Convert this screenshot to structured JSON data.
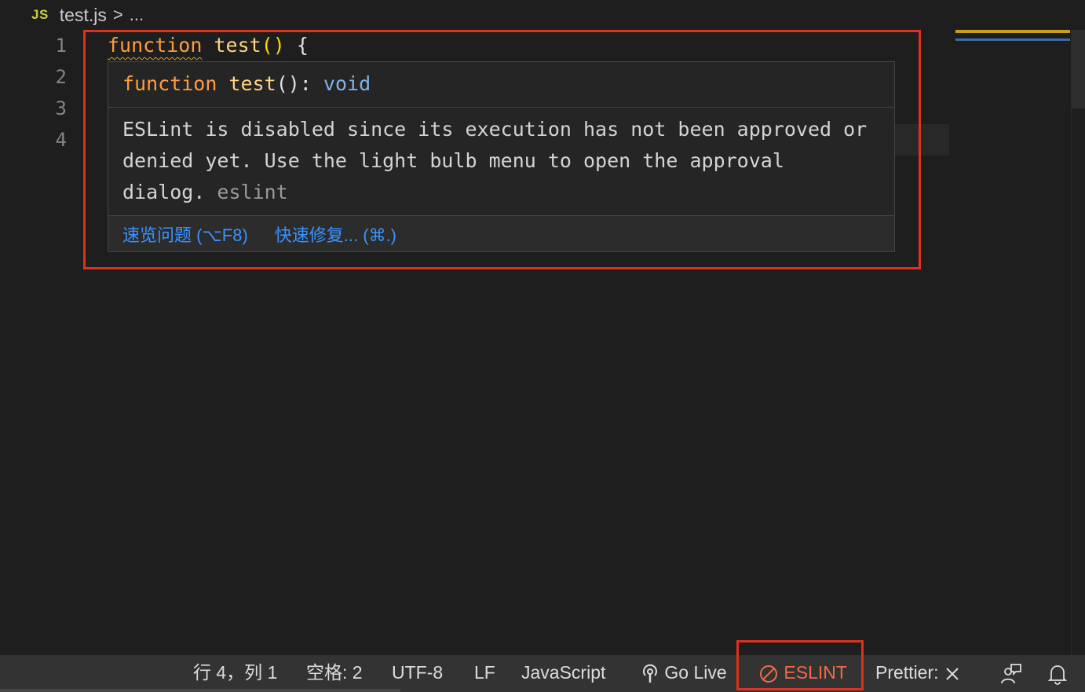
{
  "breadcrumb": {
    "file_icon": "JS",
    "file_name": "test.js",
    "separator": ">",
    "more": "..."
  },
  "gutter": {
    "line_numbers": [
      "1",
      "2",
      "3",
      "4"
    ]
  },
  "code": {
    "line1": {
      "keyword": "function",
      "space": " ",
      "name": "test",
      "parens": "()",
      "space2": " ",
      "brace": "{"
    }
  },
  "hover": {
    "signature": {
      "keyword": "function",
      "name": "test",
      "parens": "():",
      "type": "void"
    },
    "message": "ESLint is disabled since its execution has not been approved or denied yet. Use the light bulb menu to open the approval dialog.",
    "source": "eslint",
    "actions": {
      "peek_problem": "速览问题 (⌥F8)",
      "quick_fix": "快速修复... (⌘.)"
    }
  },
  "statusbar": {
    "position": "行 4，列 1",
    "spaces": "空格: 2",
    "encoding": "UTF-8",
    "eol": "LF",
    "language": "JavaScript",
    "go_live": "Go Live",
    "eslint": "ESLINT",
    "prettier": "Prettier:"
  },
  "colors": {
    "annotation": "#e0301e",
    "eslint_status": "#f06a4a",
    "link": "#3794ff"
  }
}
